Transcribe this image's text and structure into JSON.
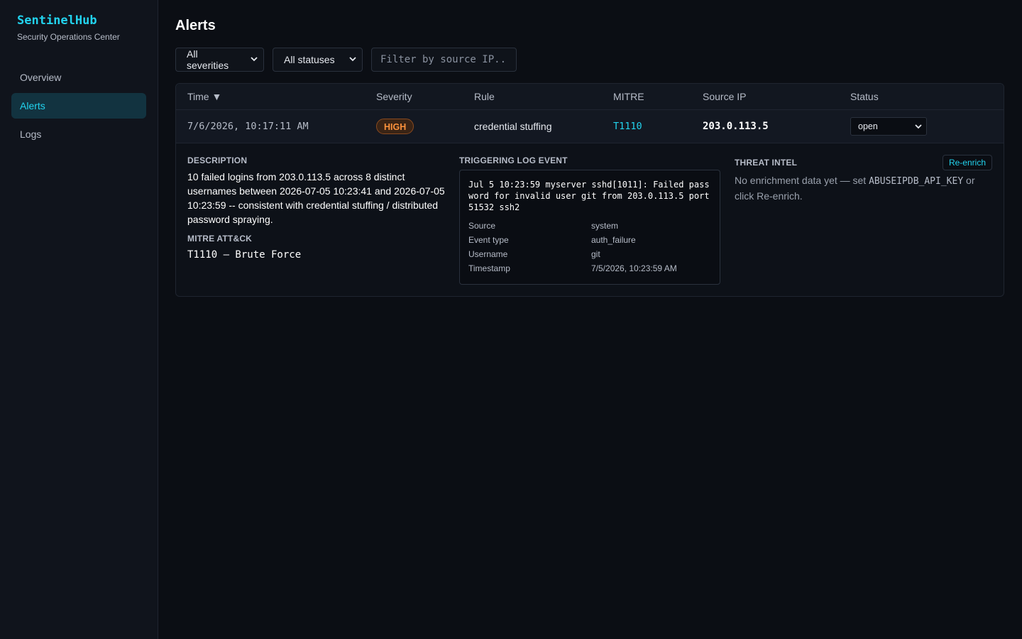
{
  "sidebar": {
    "brand": "SentinelHub",
    "subtitle": "Security Operations Center",
    "items": [
      {
        "label": "Overview",
        "active": false
      },
      {
        "label": "Alerts",
        "active": true
      },
      {
        "label": "Logs",
        "active": false
      }
    ]
  },
  "page": {
    "title": "Alerts"
  },
  "filters": {
    "severity_selected": "All severities",
    "status_selected": "All statuses",
    "ip_placeholder": "Filter by source IP.."
  },
  "table": {
    "headers": {
      "time": "Time ▼",
      "severity": "Severity",
      "rule": "Rule",
      "mitre": "MITRE",
      "source_ip": "Source IP",
      "status": "Status"
    },
    "rows": [
      {
        "time": "7/6/2026, 10:17:11 AM",
        "severity": "HIGH",
        "rule": "credential stuffing",
        "mitre": "T1110",
        "source_ip": "203.0.113.5",
        "status": "open"
      }
    ]
  },
  "detail": {
    "description_label": "DESCRIPTION",
    "description": "10 failed logins from 203.0.113.5 across 8 distinct usernames between 2026-07-05 10:23:41 and 2026-07-05 10:23:59 -- consistent with credential stuffing / distributed password spraying.",
    "mitre_label": "MITRE ATT&CK",
    "mitre_full": "T1110 — Brute Force",
    "log_label": "TRIGGERING LOG EVENT",
    "raw_log": "Jul 5 10:23:59 myserver sshd[1011]: Failed password for invalid user git from 203.0.113.5 port 51532 ssh2",
    "log_fields": [
      {
        "key": "Source",
        "value": "system"
      },
      {
        "key": "Event type",
        "value": "auth_failure"
      },
      {
        "key": "Username",
        "value": "git"
      },
      {
        "key": "Timestamp",
        "value": "7/5/2026, 10:23:59 AM"
      }
    ],
    "threat_intel_label": "THREAT INTEL",
    "reenrich_label": "Re-enrich",
    "ti_text_before": "No enrichment data yet — set ",
    "ti_env_var": "ABUSEIPDB_API_KEY",
    "ti_text_after": " or click Re-enrich."
  },
  "colors": {
    "accent": "#22d3ee",
    "severity_high": "#fb923c",
    "background": "#0b0e14",
    "sidebar_bg": "#10141c"
  },
  "icons": {
    "sort": "sort-desc-icon",
    "dropdown": "chevron-down-icon"
  }
}
